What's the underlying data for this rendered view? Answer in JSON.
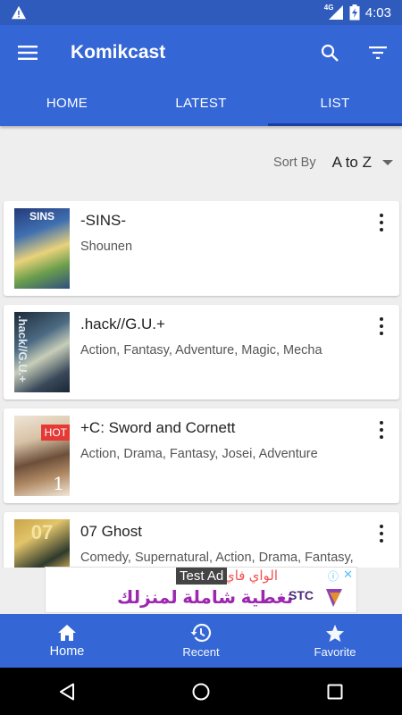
{
  "status_bar": {
    "time": "4:03",
    "network": "4G"
  },
  "app_bar": {
    "title": "Komikcast"
  },
  "tabs": [
    {
      "label": "HOME"
    },
    {
      "label": "LATEST"
    },
    {
      "label": "LIST",
      "active": true
    }
  ],
  "sort": {
    "label": "Sort By",
    "value": "A to Z"
  },
  "comics": [
    {
      "title": "-SINS-",
      "genres": "Shounen",
      "cover_text": "SINS"
    },
    {
      "title": ".hack//G.U.+",
      "genres": "Action, Fantasy, Adventure, Magic, Mecha",
      "cover_text": ".hack//G.U.+"
    },
    {
      "title": "+C: Sword and Cornett",
      "genres": "Action, Drama, Fantasy, Josei, Adventure",
      "cover_text": "1",
      "badge": "HOT"
    },
    {
      "title": "07 Ghost",
      "genres": "Comedy, Supernatural, Action, Drama, Fantasy,",
      "cover_text": "07"
    }
  ],
  "ad": {
    "label": "Test Ad",
    "line1": "الواي فاي",
    "line2": "تغطية شاملة لمنزلك",
    "brand": "STC"
  },
  "bottom_nav": [
    {
      "label": "Home",
      "icon": "home-icon",
      "active": true
    },
    {
      "label": "Recent",
      "icon": "history-icon"
    },
    {
      "label": "Favorite",
      "icon": "star-icon"
    }
  ],
  "colors": {
    "primary": "#3466d6",
    "status_bar": "#2f5bbd",
    "tab_indicator": "#1a3fa3",
    "hot_badge": "#e53935"
  }
}
